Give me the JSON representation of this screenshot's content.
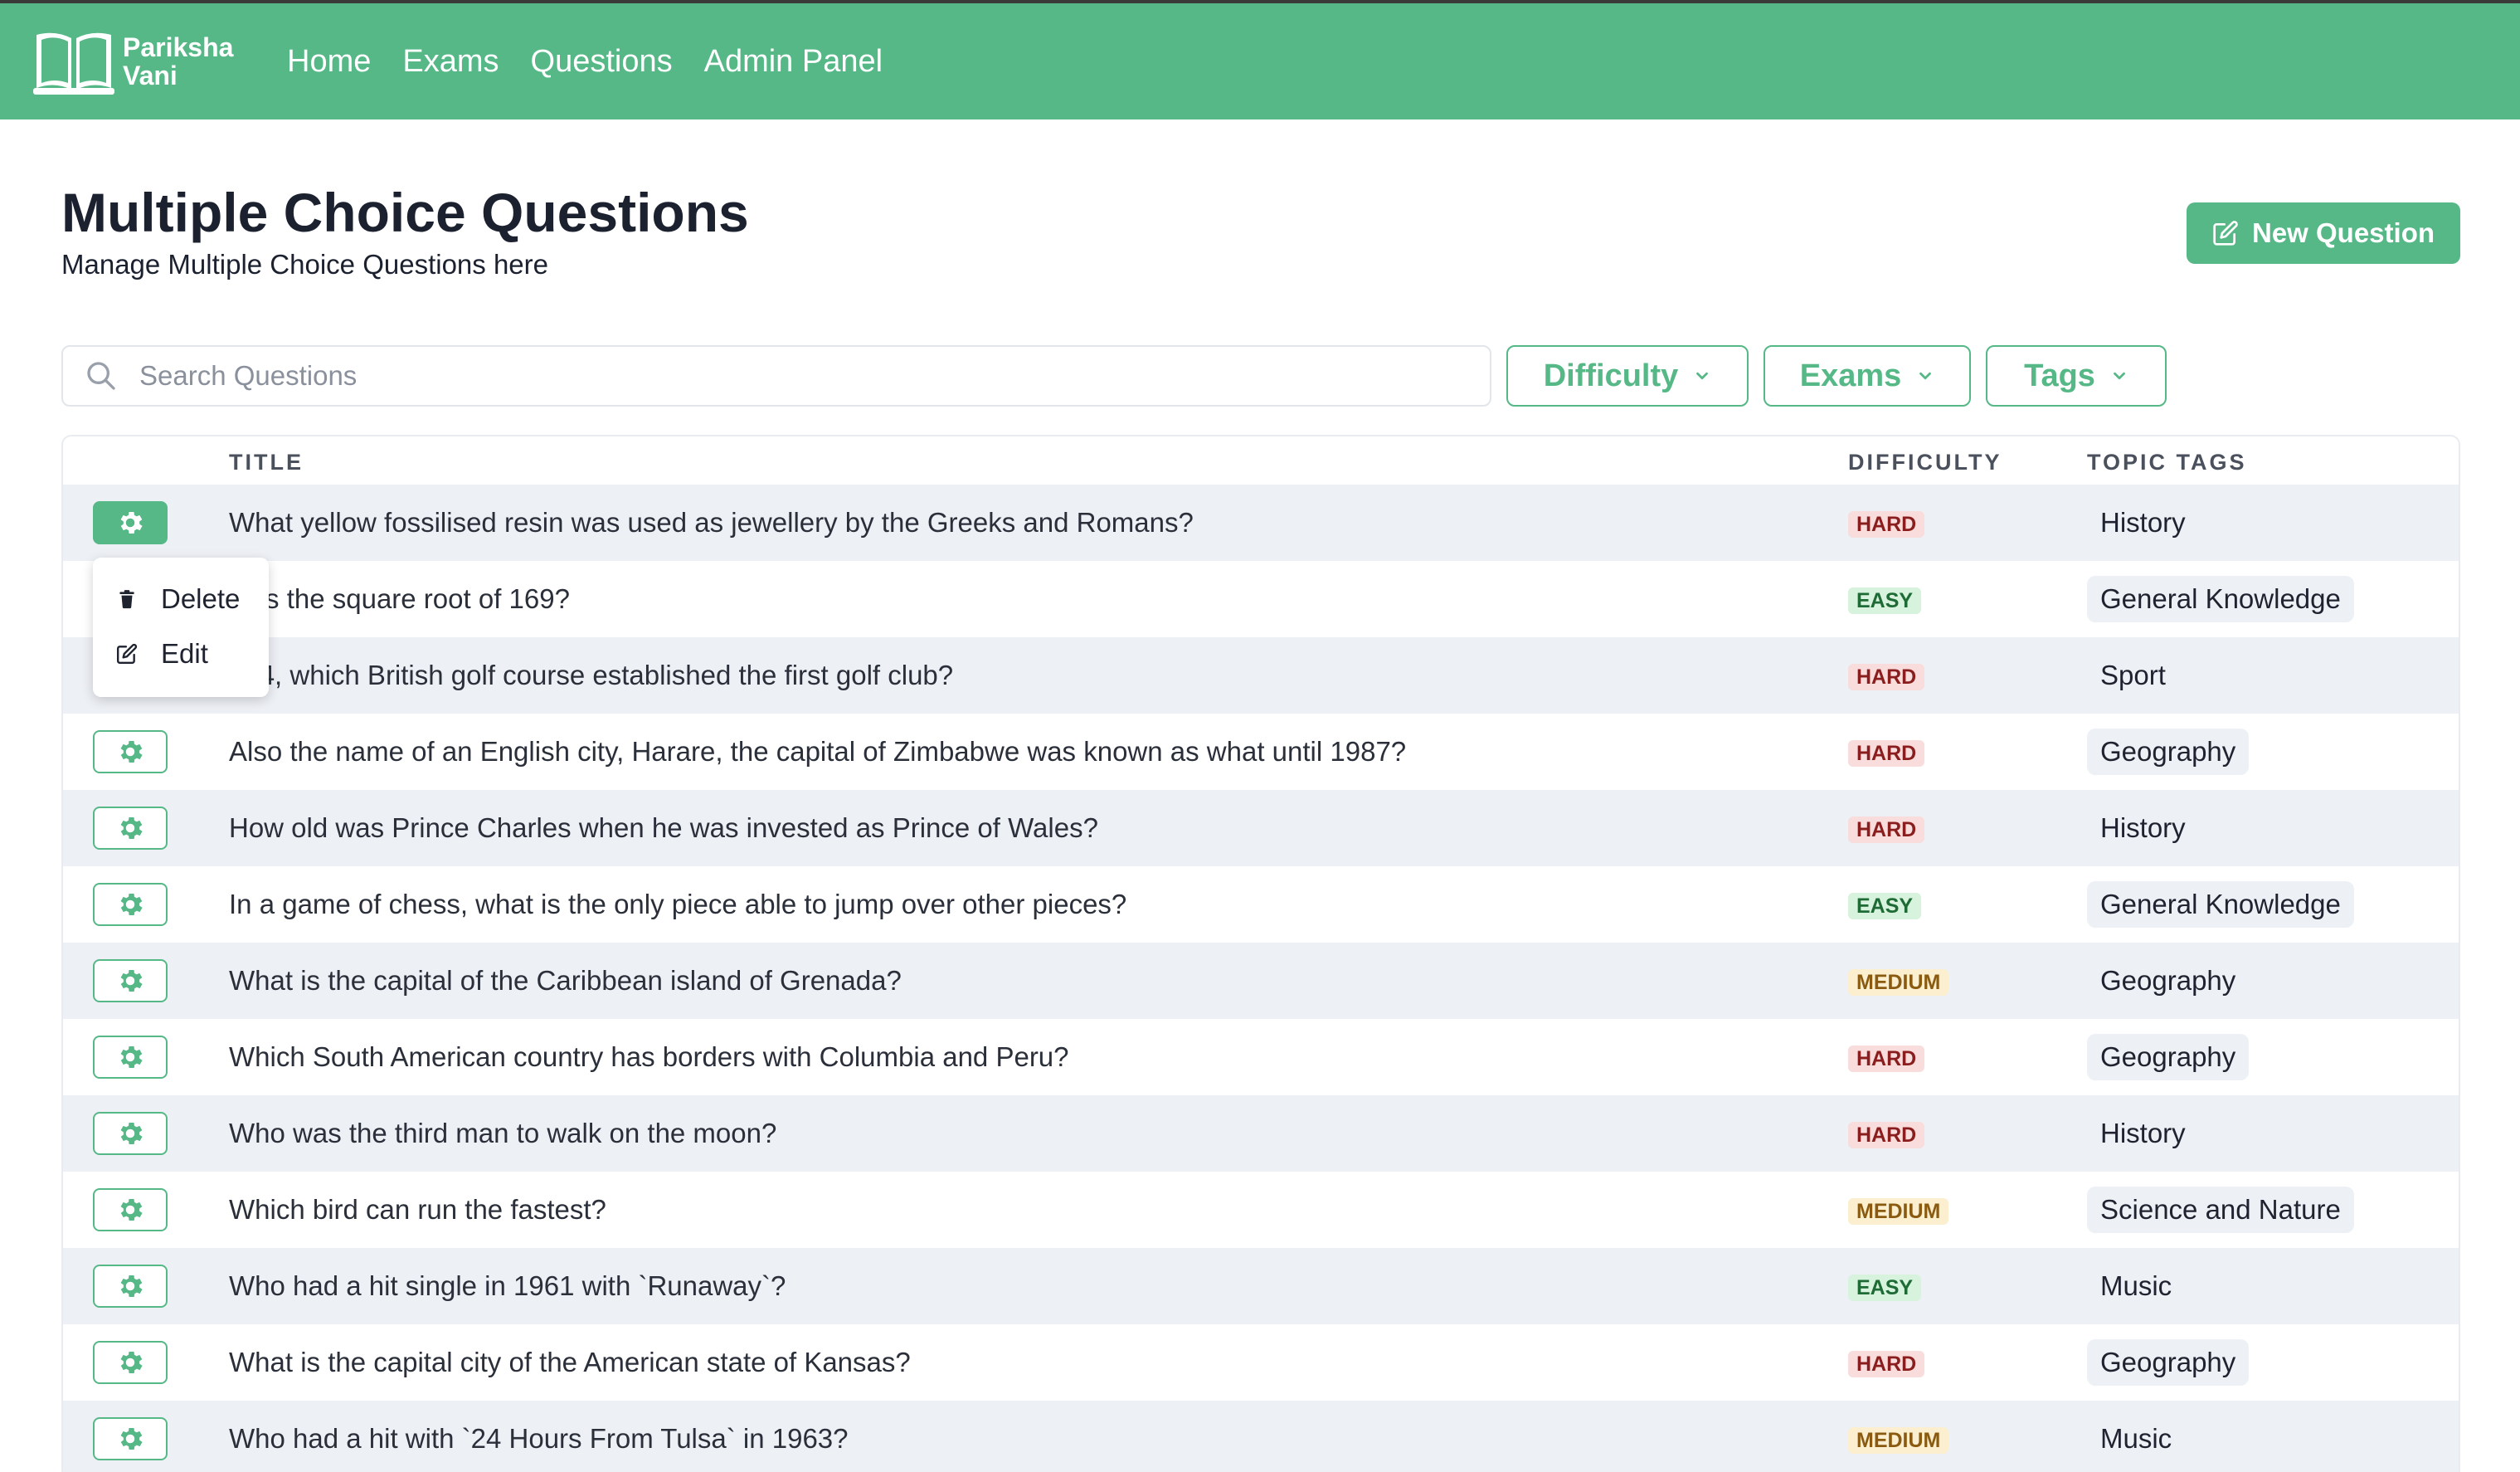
{
  "app": {
    "name_line1": "Pariksha",
    "name_line2": "Vani"
  },
  "nav": {
    "items": [
      "Home",
      "Exams",
      "Questions",
      "Admin Panel"
    ]
  },
  "page": {
    "title": "Multiple Choice Questions",
    "subtitle": "Manage Multiple Choice Questions here"
  },
  "toolbar": {
    "new_question_label": "New Question"
  },
  "search": {
    "placeholder": "Search Questions",
    "value": ""
  },
  "filters": {
    "difficulty": "Difficulty",
    "exams": "Exams",
    "tags": "Tags"
  },
  "table": {
    "headers": {
      "title": "TITLE",
      "difficulty": "DIFFICULTY",
      "topic_tags": "TOPIC TAGS"
    },
    "rows": [
      {
        "title": "What yellow fossilised resin was used as jewellery by the Greeks and Romans?",
        "difficulty": "HARD",
        "tag": "History"
      },
      {
        "title": "at is the square root of 169?",
        "difficulty": "EASY",
        "tag": "General Knowledge"
      },
      {
        "title": "744, which British golf course established the first golf club?",
        "difficulty": "HARD",
        "tag": "Sport"
      },
      {
        "title": "Also the name of an English city, Harare, the capital of Zimbabwe was known as what until 1987?",
        "difficulty": "HARD",
        "tag": "Geography"
      },
      {
        "title": "How old was Prince Charles when he was invested as Prince of Wales?",
        "difficulty": "HARD",
        "tag": "History"
      },
      {
        "title": "In a game of chess, what is the only piece able to jump over other pieces?",
        "difficulty": "EASY",
        "tag": "General Knowledge"
      },
      {
        "title": "What is the capital of the Caribbean island of Grenada?",
        "difficulty": "MEDIUM",
        "tag": "Geography"
      },
      {
        "title": "Which South American country has borders with Columbia and Peru?",
        "difficulty": "HARD",
        "tag": "Geography"
      },
      {
        "title": "Who was the third man to walk on the moon?",
        "difficulty": "HARD",
        "tag": "History"
      },
      {
        "title": "Which bird can run the fastest?",
        "difficulty": "MEDIUM",
        "tag": "Science and Nature"
      },
      {
        "title": "Who had a hit single in 1961 with `Runaway`?",
        "difficulty": "EASY",
        "tag": "Music"
      },
      {
        "title": "What is the capital city of the American state of Kansas?",
        "difficulty": "HARD",
        "tag": "Geography"
      },
      {
        "title": "Who had a hit with `24 Hours From Tulsa` in 1963?",
        "difficulty": "MEDIUM",
        "tag": "Music"
      }
    ]
  },
  "context_menu": {
    "delete": "Delete",
    "edit": "Edit"
  },
  "colors": {
    "brand": "#55b886",
    "row_alt": "#edf0f5",
    "hard_bg": "#f9dcdc",
    "easy_bg": "#d7f2dd",
    "medium_bg": "#fbefcf"
  },
  "icons": {
    "logo": "open-book-icon",
    "search": "search-icon",
    "new": "edit-square-icon",
    "chevron": "chevron-down-icon",
    "gear": "gear-icon",
    "delete": "trash-icon",
    "edit": "edit-square-icon"
  }
}
